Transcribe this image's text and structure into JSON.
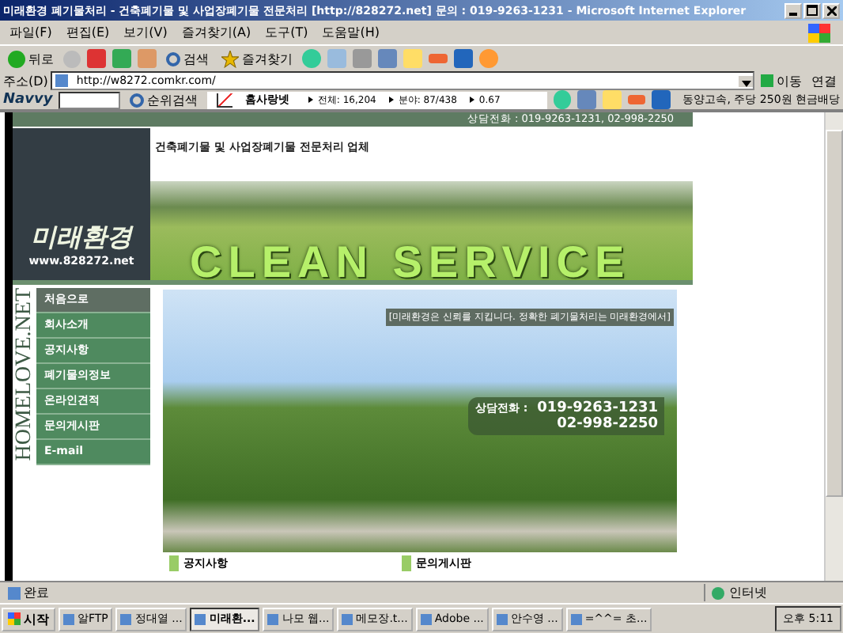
{
  "window": {
    "title": "미래환경 폐기물처리 - 건축폐기물 및 사업장폐기물 전문처리 [http://828272.net] 문의 : 019-9263-1231 - Microsoft Internet Explorer"
  },
  "menu": [
    "파일(F)",
    "편집(E)",
    "보기(V)",
    "즐겨찾기(A)",
    "도구(T)",
    "도움말(H)"
  ],
  "toolbar": {
    "back": "뒤로",
    "search": "검색",
    "favorites": "즐겨찾기"
  },
  "address": {
    "label": "주소(D)",
    "value": "http://w8272.comkr.com/",
    "go": "이동",
    "links": "연결"
  },
  "navvy": {
    "brand": "Navvy",
    "rank_search": "순위검색",
    "site": "홈사랑넷",
    "total": "전체: 16,204",
    "field": "분야: 87/438",
    "score": "0.67",
    "ticker": "동양고속, 주당 250원 현금배당"
  },
  "page": {
    "phone_bar": "상담전화 : 019-9263-1231, 02-998-2250",
    "logo": "미래환경",
    "logo_url": "www.828272.net",
    "tagline": "건축폐기물 및 사업장폐기물 전문처리 업체",
    "banner_text": "CLEAN SERVICE",
    "vertical_brand": "HOMELOVE.NET",
    "nav": [
      {
        "label": "처음으로",
        "selected": true
      },
      {
        "label": "회사소개",
        "selected": false
      },
      {
        "label": "공지사항",
        "selected": false
      },
      {
        "label": "폐기물의정보",
        "selected": false
      },
      {
        "label": "온라인견적",
        "selected": false
      },
      {
        "label": "문의게시판",
        "selected": false
      },
      {
        "label": "E-mail",
        "selected": false
      }
    ],
    "slogan": "[미래환경은 신뢰를 지킵니다. 정확한 폐기물처리는 미래환경에서]",
    "contact_label": "상담전화 :",
    "contact_phones": [
      "019-9263-1231",
      "02-998-2250"
    ],
    "boards": [
      "공지사항",
      "문의게시판"
    ]
  },
  "status_bar": {
    "text": "완료",
    "zone": "인터넷"
  },
  "taskbar": {
    "start": "시작",
    "tasks": [
      {
        "label": "알FTP",
        "selected": false
      },
      {
        "label": "정대열 ...",
        "selected": false
      },
      {
        "label": "미래환...",
        "selected": true
      },
      {
        "label": "나모 웹...",
        "selected": false
      },
      {
        "label": "메모장.t...",
        "selected": false
      },
      {
        "label": "Adobe ...",
        "selected": false
      },
      {
        "label": "안수영 ...",
        "selected": false
      },
      {
        "label": "=^^= 초...",
        "selected": false
      }
    ],
    "clock": "오후 5:11"
  }
}
